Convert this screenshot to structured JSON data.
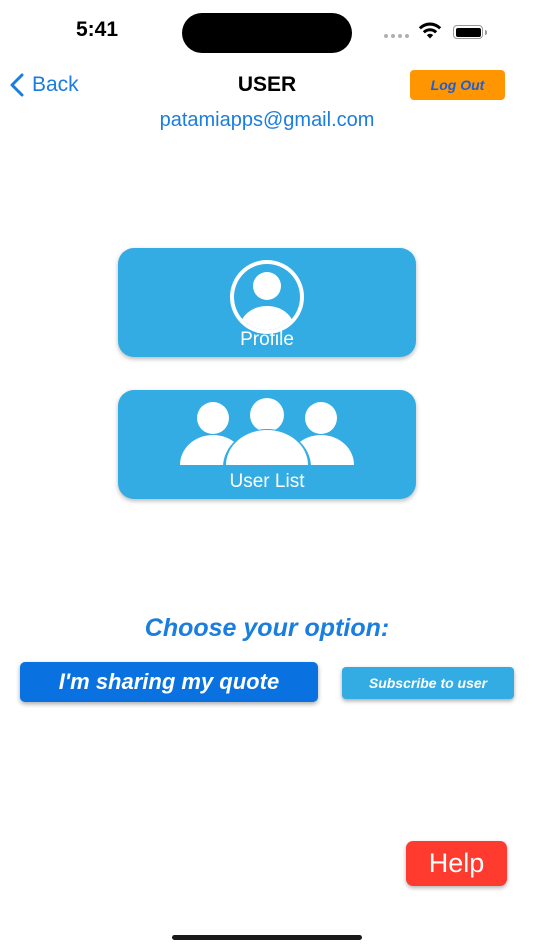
{
  "status_bar": {
    "time": "5:41",
    "icons": [
      "signal-icon",
      "wifi-icon",
      "battery-icon"
    ]
  },
  "nav": {
    "back_label": "Back",
    "title": "USER",
    "logout_label": "Log Out"
  },
  "user": {
    "email": "patamiapps@gmail.com"
  },
  "tiles": [
    {
      "label": "Profile",
      "icon": "profile-icon"
    },
    {
      "label": "User List",
      "icon": "user-group-icon"
    }
  ],
  "options": {
    "heading": "Choose your option:",
    "quote_label": "I'm sharing my quote",
    "subscribe_label": "Subscribe to user"
  },
  "help": {
    "label": "Help"
  },
  "colors": {
    "accent": "#1a7de0",
    "tile": "#33ace4",
    "logout": "#ff9500",
    "help": "#ff3b30",
    "primary_button": "#0a72e0"
  }
}
